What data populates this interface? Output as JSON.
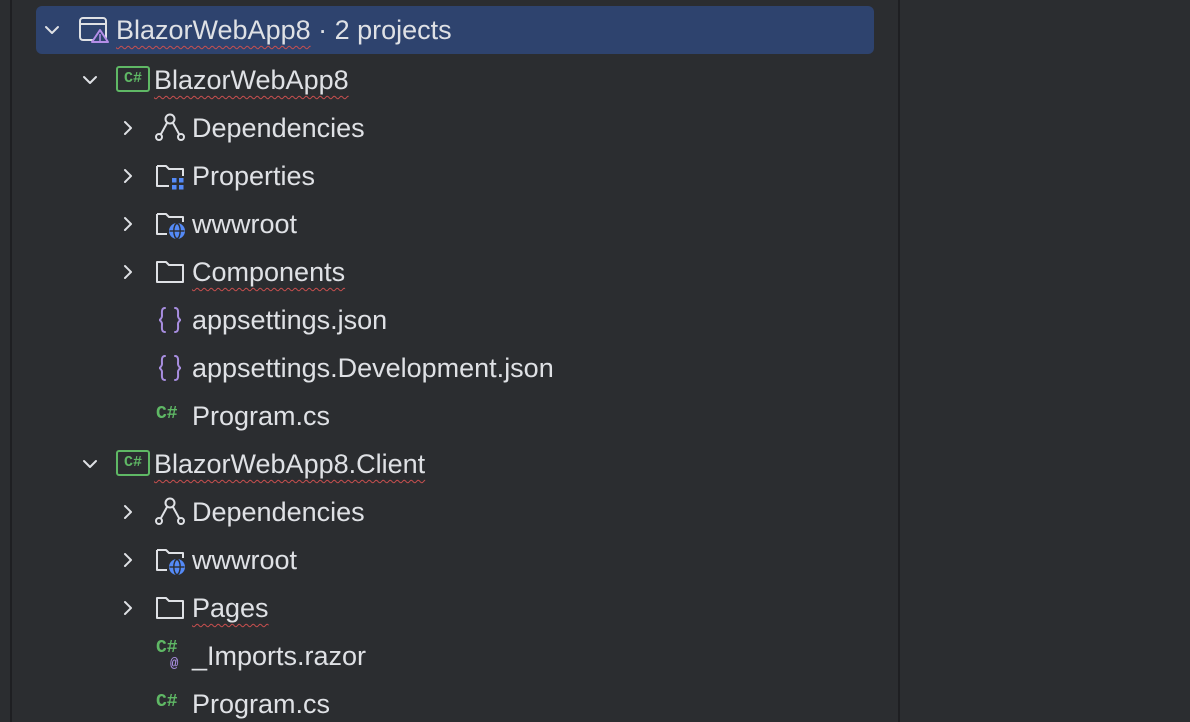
{
  "solution": {
    "name": "BlazorWebApp8",
    "suffix": " · 2 projects"
  },
  "projects": [
    {
      "name": "BlazorWebApp8",
      "items": [
        {
          "label": "Dependencies"
        },
        {
          "label": "Properties"
        },
        {
          "label": "wwwroot"
        },
        {
          "label": "Components"
        },
        {
          "label": "appsettings.json"
        },
        {
          "label": "appsettings.Development.json"
        },
        {
          "label": "Program.cs"
        }
      ]
    },
    {
      "name": "BlazorWebApp8.Client",
      "items": [
        {
          "label": "Dependencies"
        },
        {
          "label": "wwwroot"
        },
        {
          "label": "Pages"
        },
        {
          "label": "_Imports.razor"
        },
        {
          "label": "Program.cs"
        }
      ]
    }
  ],
  "icons": {
    "csharp_badge": "C#",
    "cs_file": "C#",
    "razor_at": "@"
  },
  "colors": {
    "background": "#2b2d30",
    "selection": "#2e436e",
    "text": "#dfe1e5",
    "csharp_green": "#5fb865",
    "json_purple": "#a88ee0",
    "folder_blue": "#548af7",
    "error_squiggle": "#c94f4f"
  }
}
